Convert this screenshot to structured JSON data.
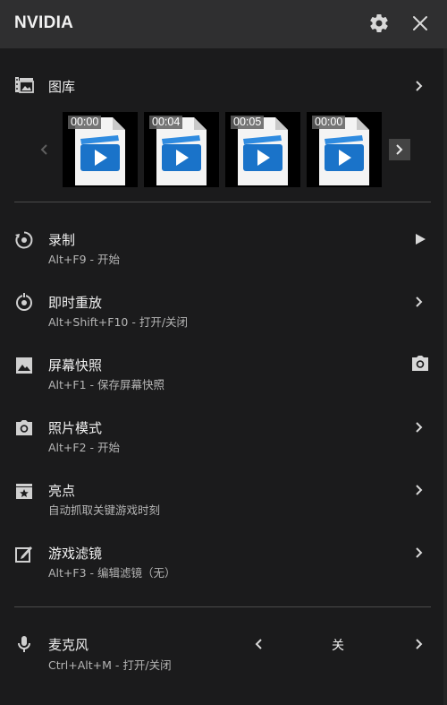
{
  "header": {
    "title": "NVIDIA"
  },
  "gallery": {
    "label": "图库",
    "thumbnails": [
      {
        "duration": "00:00"
      },
      {
        "duration": "00:04"
      },
      {
        "duration": "00:05"
      },
      {
        "duration": "00:00"
      }
    ]
  },
  "items": [
    {
      "title": "录制",
      "subtitle": "Alt+F9 - 开始",
      "action_icon": "play-icon"
    },
    {
      "title": "即时重放",
      "subtitle": "Alt+Shift+F10 - 打开/关闭",
      "action_icon": "chevron-right-icon"
    },
    {
      "title": "屏幕快照",
      "subtitle": "Alt+F1 - 保存屏幕快照",
      "action_icon": "camera-icon"
    },
    {
      "title": "照片模式",
      "subtitle": "Alt+F2 - 开始",
      "action_icon": "chevron-right-icon"
    },
    {
      "title": "亮点",
      "subtitle": "自动抓取关键游戏时刻",
      "action_icon": "chevron-right-icon"
    },
    {
      "title": "游戏滤镜",
      "subtitle": "Alt+F3 - 编辑滤镜（无）",
      "action_icon": "chevron-right-icon"
    }
  ],
  "microphone": {
    "title": "麦克风",
    "subtitle": "Ctrl+Alt+M - 打开/关闭",
    "value": "关"
  },
  "colors": {
    "background": "#1b1b1c",
    "header": "#2f2f30",
    "file_blue": "#1a73c9"
  }
}
